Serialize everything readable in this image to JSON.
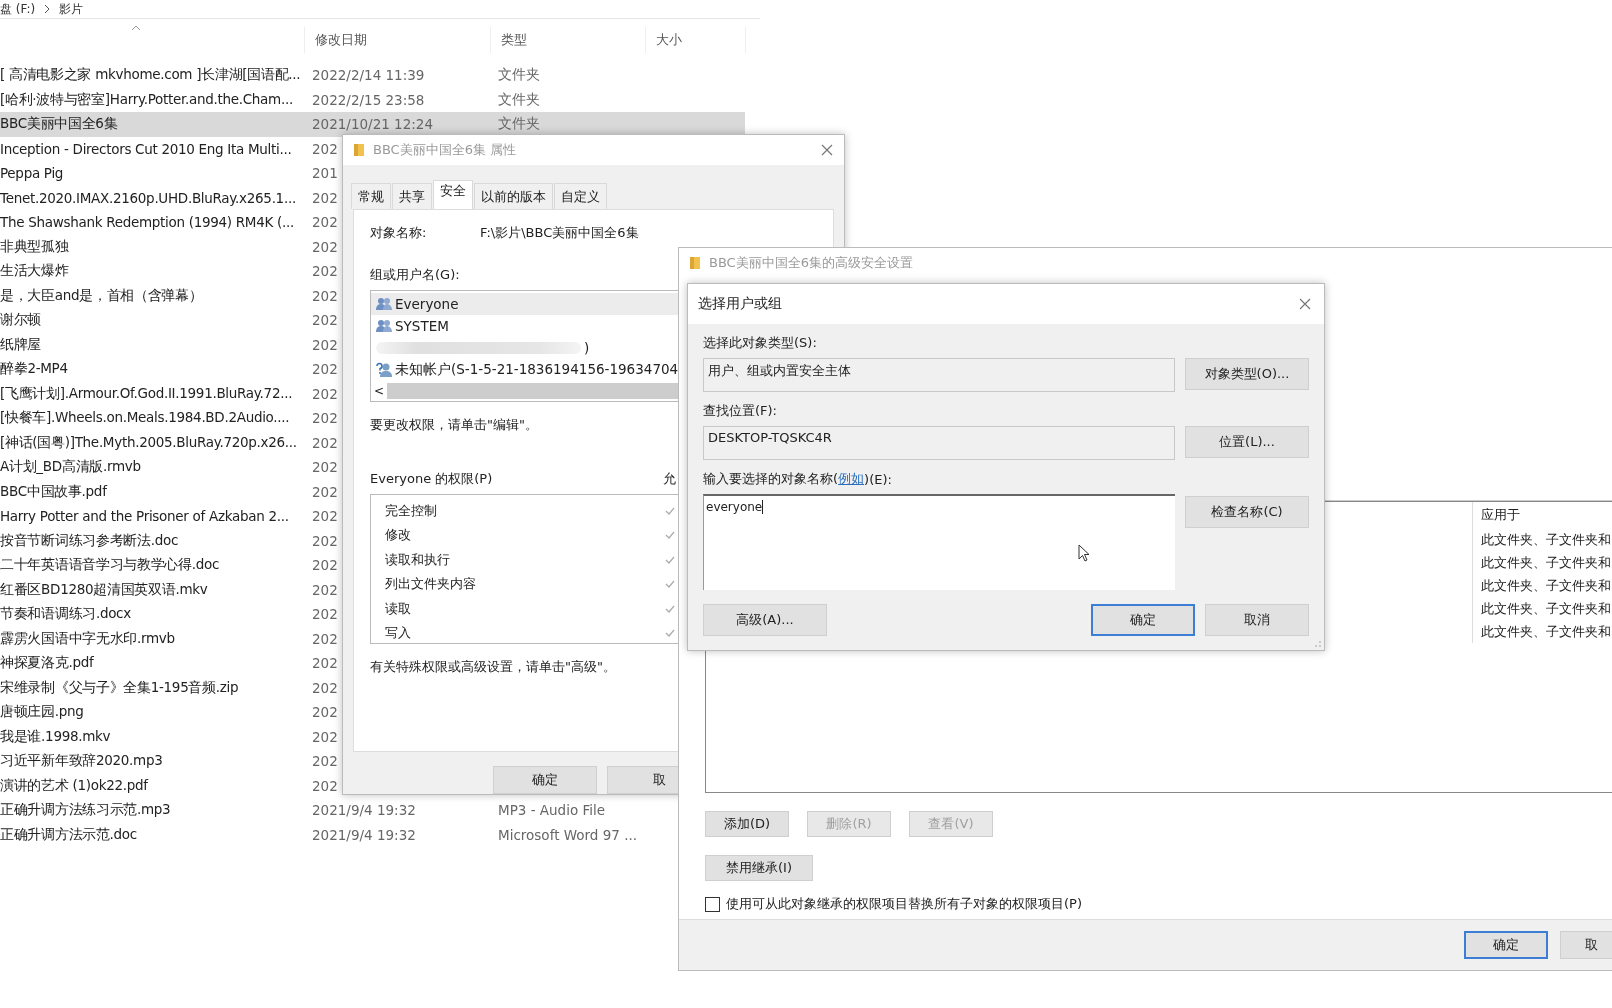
{
  "explorer": {
    "breadcrumb": [
      "盘 (F:)",
      "影片"
    ],
    "columns": [
      "修改日期",
      "类型",
      "大小"
    ],
    "rows": [
      {
        "name": "[ 高清电影之家 mkvhome.com ]长津湖[国语配...",
        "date": "2022/2/14 11:39",
        "type": "文件夹",
        "selected": false
      },
      {
        "name": "[哈利·波特与密室]Harry.Potter.and.the.Cham...",
        "date": "2022/2/15 23:58",
        "type": "文件夹",
        "selected": false
      },
      {
        "name": "BBC美丽中国全6集",
        "date": "2021/10/21 12:24",
        "type": "文件夹",
        "selected": true
      },
      {
        "name": "Inception - Directors Cut 2010 Eng Ita Multi...",
        "date": "202",
        "selected": false
      },
      {
        "name": "Peppa Pig",
        "date": "201",
        "selected": false
      },
      {
        "name": "Tenet.2020.IMAX.2160p.UHD.BluRay.x265.1...",
        "date": "202",
        "selected": false
      },
      {
        "name": "The Shawshank Redemption (1994) RM4K (...",
        "date": "202",
        "selected": false
      },
      {
        "name": "非典型孤独",
        "date": "202",
        "selected": false
      },
      {
        "name": "生活大爆炸",
        "date": "202",
        "selected": false
      },
      {
        "name": "是，大臣and是，首相（含弹幕）",
        "date": "202",
        "selected": false
      },
      {
        "name": "谢尔顿",
        "date": "202",
        "selected": false
      },
      {
        "name": "纸牌屋",
        "date": "202",
        "selected": false
      },
      {
        "name": "醉拳2-MP4",
        "date": "202",
        "selected": false
      },
      {
        "name": "[飞鹰计划].Armour.Of.God.II.1991.BluRay.72...",
        "date": "202",
        "selected": false
      },
      {
        "name": "[快餐车].Wheels.on.Meals.1984.BD.2Audio....",
        "date": "202",
        "selected": false
      },
      {
        "name": "[神话(国粤)]The.Myth.2005.BluRay.720p.x26...",
        "date": "202",
        "selected": false
      },
      {
        "name": "A计划_BD高清版.rmvb",
        "date": "202",
        "selected": false
      },
      {
        "name": "BBC中国故事.pdf",
        "date": "202",
        "selected": false
      },
      {
        "name": "Harry Potter and the Prisoner of Azkaban 2...",
        "date": "202",
        "selected": false
      },
      {
        "name": "按音节断词练习参考断法.doc",
        "date": "202",
        "selected": false
      },
      {
        "name": "二十年英语语音学习与教学心得.doc",
        "date": "202",
        "selected": false
      },
      {
        "name": "红番区BD1280超清国英双语.mkv",
        "date": "202",
        "selected": false
      },
      {
        "name": "节奏和语调练习.docx",
        "date": "202",
        "selected": false
      },
      {
        "name": "霹雳火国语中字无水印.rmvb",
        "date": "202",
        "selected": false
      },
      {
        "name": "神探夏洛克.pdf",
        "date": "202",
        "selected": false
      },
      {
        "name": "宋维录制《父与子》全集1-195音频.zip",
        "date": "202",
        "selected": false
      },
      {
        "name": "唐顿庄园.png",
        "date": "202",
        "selected": false
      },
      {
        "name": "我是谁.1998.mkv",
        "date": "202",
        "selected": false
      },
      {
        "name": "习近平新年致辞2020.mp3",
        "date": "202",
        "selected": false
      },
      {
        "name": "演讲的艺术 (1)ok22.pdf",
        "date": "202",
        "selected": false
      },
      {
        "name": "正确升调方法练习示范.mp3",
        "date": "2021/9/4 19:32",
        "type": "MP3 - Audio File",
        "selected": false
      },
      {
        "name": "正确升调方法示范.doc",
        "date": "2021/9/4 19:32",
        "type": "Microsoft Word 97 ...",
        "selected": false
      }
    ]
  },
  "properties_dialog": {
    "title": "BBC美丽中国全6集 属性",
    "tabs": [
      {
        "label": "常规",
        "selected": false
      },
      {
        "label": "共享",
        "selected": false
      },
      {
        "label": "安全",
        "selected": true
      },
      {
        "label": "以前的版本",
        "selected": false
      },
      {
        "label": "自定义",
        "selected": false
      }
    ],
    "object_name_label": "对象名称:",
    "object_name": "F:\\影片\\BBC美丽中国全6集",
    "groups_label": "组或用户名(G):",
    "groups": [
      {
        "kind": "group",
        "name": "Everyone",
        "selected": true
      },
      {
        "kind": "group",
        "name": "SYSTEM",
        "selected": false
      },
      {
        "kind": "blurred",
        "name": ")",
        "selected": false
      },
      {
        "kind": "unknown",
        "name": "未知帐户(S-1-5-21-1836194156-19634704",
        "selected": false
      }
    ],
    "scroll_left": "<",
    "edit_hint": "要更改权限，请单击\"编辑\"。",
    "permissions_label": "Everyone 的权限(P)",
    "allow_column": "允",
    "permissions": [
      {
        "name": "完全控制",
        "allowed": true
      },
      {
        "name": "修改",
        "allowed": true
      },
      {
        "name": "读取和执行",
        "allowed": true
      },
      {
        "name": "列出文件夹内容",
        "allowed": true
      },
      {
        "name": "读取",
        "allowed": true
      },
      {
        "name": "写入",
        "allowed": true
      }
    ],
    "advanced_hint": "有关特殊权限或高级设置，请单击\"高级\"。",
    "buttons": [
      "确定",
      "取"
    ]
  },
  "advanced_dialog": {
    "title": "BBC美丽中国全6集的高级安全设置",
    "applies_to_column": "应用于",
    "applies_to": [
      "此文件夹、子文件夹和",
      "此文件夹、子文件夹和",
      "此文件夹、子文件夹和",
      "此文件夹、子文件夹和",
      "此文件夹、子文件夹和"
    ],
    "buttons": [
      {
        "label": "添加(D)",
        "disabled": false
      },
      {
        "label": "删除(R)",
        "disabled": true
      },
      {
        "label": "查看(V)",
        "disabled": true
      }
    ],
    "disable_inheritance": "禁用继承(I)",
    "replace_checkbox": {
      "label": "使用可从此对象继承的权限项目替换所有子对象的权限项目(P)",
      "checked": false
    },
    "footer_buttons": [
      {
        "label": "确定",
        "default": true
      },
      {
        "label": "取",
        "default": false
      }
    ]
  },
  "select_dialog": {
    "title": "选择用户或组",
    "object_type_label": "选择此对象类型(S):",
    "object_type": "用户、组或内置安全主体",
    "object_type_button": "对象类型(O)...",
    "location_label": "查找位置(F):",
    "location": "DESKTOP-TQSKC4R",
    "location_button": "位置(L)...",
    "names_label_before": "输入要选择的对象名称(",
    "names_label_link": "例如",
    "names_label_after": ")(E):",
    "names_value": "everyone",
    "check_names_button": "检查名称(C)",
    "advanced_button": "高级(A)...",
    "ok_button": "确定",
    "cancel_button": "取消"
  }
}
